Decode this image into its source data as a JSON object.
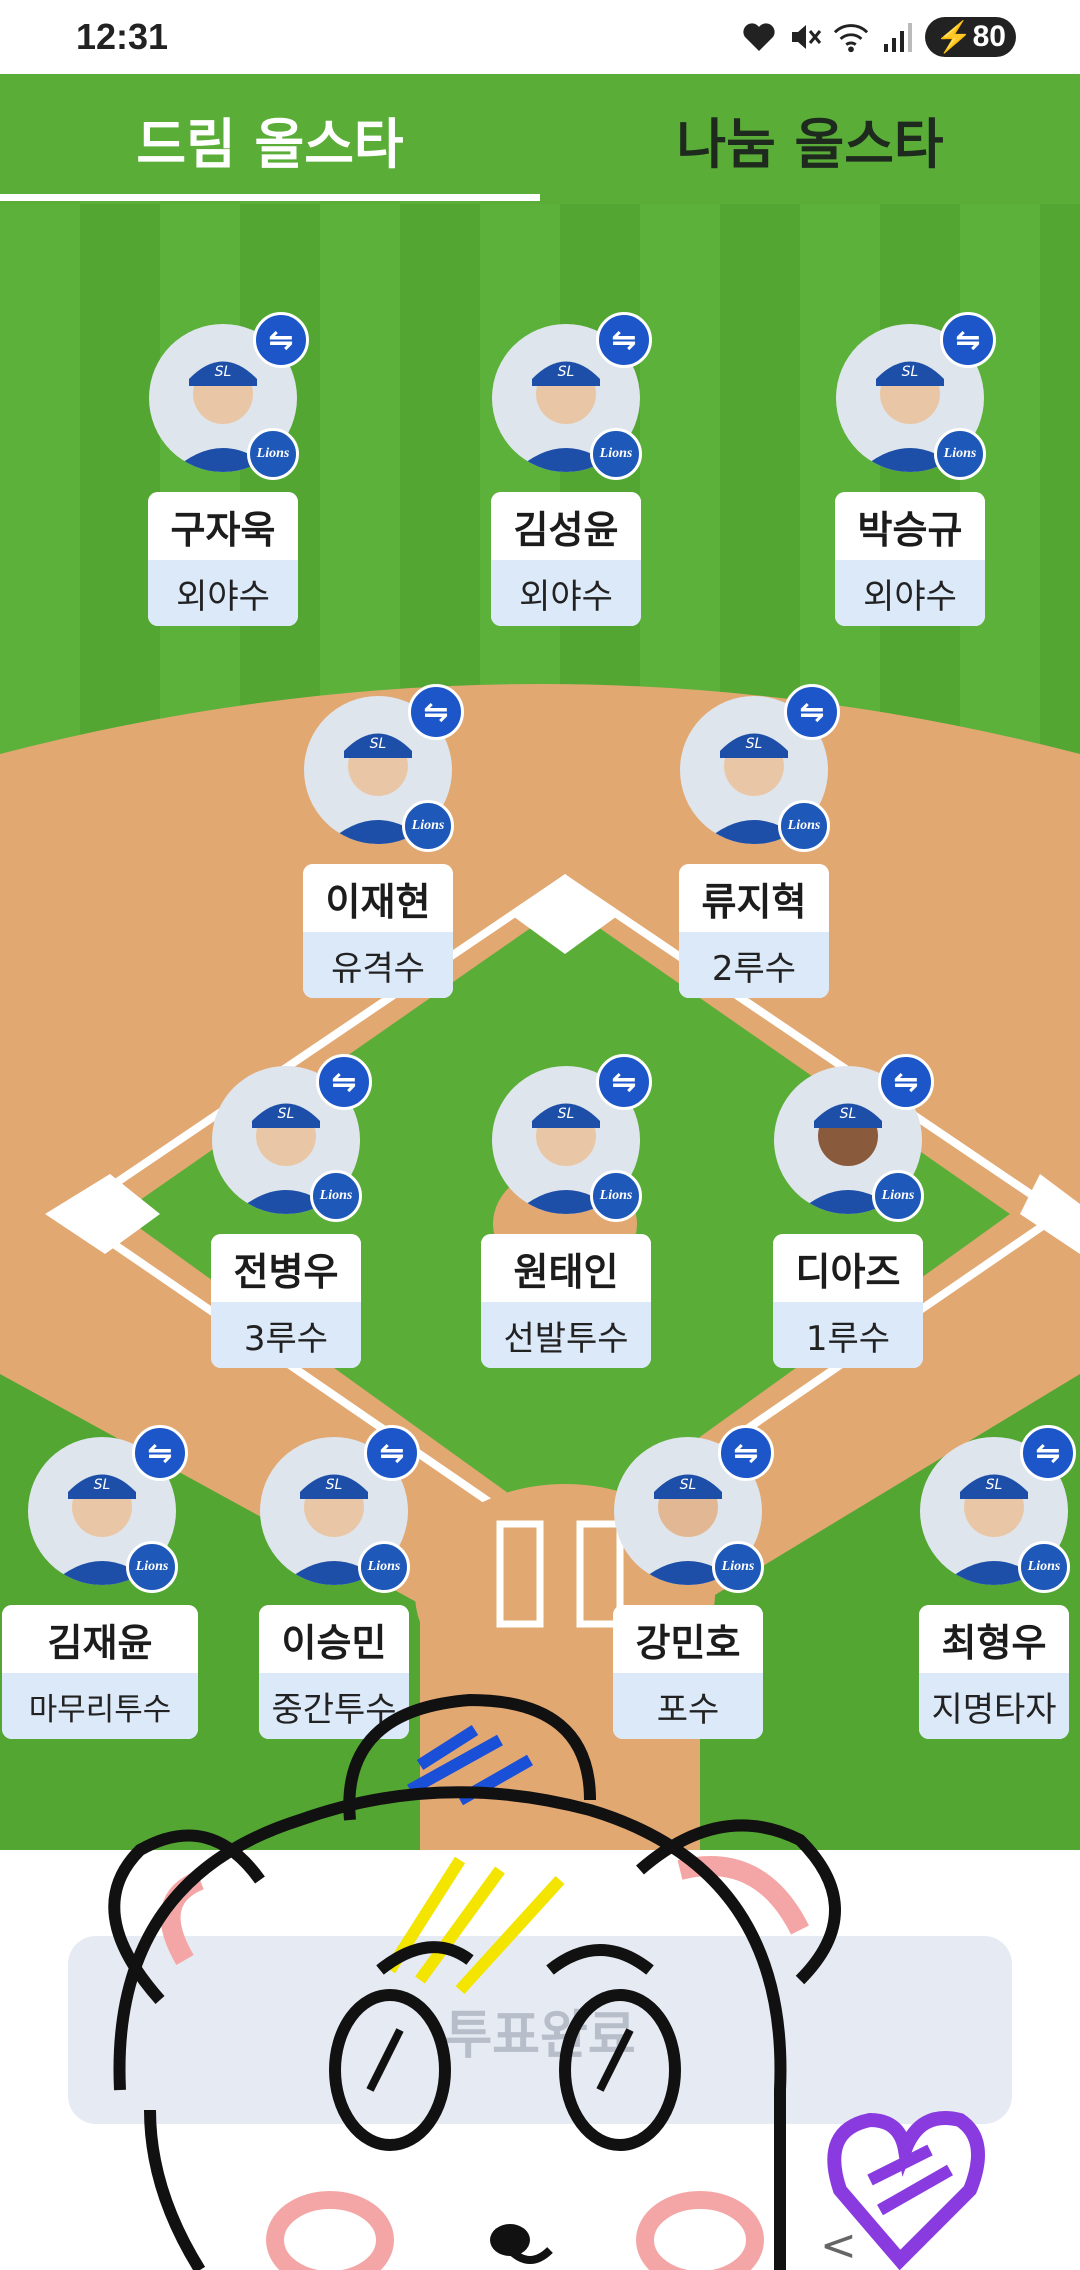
{
  "status_bar": {
    "time": "12:31",
    "battery": "80",
    "icons": [
      "heart-icon",
      "mute-icon",
      "wifi-icon",
      "signal-icon",
      "battery-icon"
    ]
  },
  "tabs": [
    {
      "label": "드림 올스타",
      "active": true
    },
    {
      "label": "나눔 올스타",
      "active": false
    }
  ],
  "players": [
    {
      "name": "구자욱",
      "position": "외야수"
    },
    {
      "name": "김성윤",
      "position": "외야수"
    },
    {
      "name": "박승규",
      "position": "외야수"
    },
    {
      "name": "이재현",
      "position": "유격수"
    },
    {
      "name": "류지혁",
      "position": "2루수"
    },
    {
      "name": "전병우",
      "position": "3루수"
    },
    {
      "name": "원태인",
      "position": "선발투수"
    },
    {
      "name": "디아즈",
      "position": "1루수"
    },
    {
      "name": "김재윤",
      "position": "마무리투수"
    },
    {
      "name": "이승민",
      "position": "중간투수"
    },
    {
      "name": "강민호",
      "position": "포수"
    },
    {
      "name": "최형우",
      "position": "지명타자"
    }
  ],
  "player_icons": {
    "swap": "swap-icon",
    "team": "lions-logo-icon",
    "team_text": "Lions",
    "cap_text": "SL"
  },
  "vote_button": {
    "label": "투표완료"
  },
  "colors": {
    "grass": "#5aae37",
    "dirt": "#e2a872",
    "swap_button": "#1c56c8",
    "position_bg": "#dce9f8"
  }
}
